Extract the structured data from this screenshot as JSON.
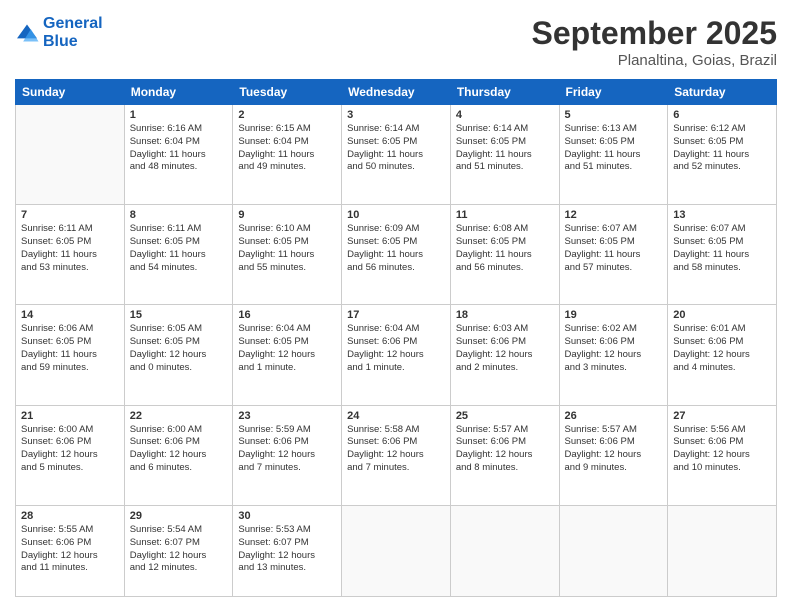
{
  "header": {
    "logo": {
      "line1": "General",
      "line2": "Blue"
    },
    "month": "September 2025",
    "location": "Planaltina, Goias, Brazil"
  },
  "days_of_week": [
    "Sunday",
    "Monday",
    "Tuesday",
    "Wednesday",
    "Thursday",
    "Friday",
    "Saturday"
  ],
  "weeks": [
    [
      {
        "day": "",
        "info": ""
      },
      {
        "day": "1",
        "info": "Sunrise: 6:16 AM\nSunset: 6:04 PM\nDaylight: 11 hours\nand 48 minutes."
      },
      {
        "day": "2",
        "info": "Sunrise: 6:15 AM\nSunset: 6:04 PM\nDaylight: 11 hours\nand 49 minutes."
      },
      {
        "day": "3",
        "info": "Sunrise: 6:14 AM\nSunset: 6:05 PM\nDaylight: 11 hours\nand 50 minutes."
      },
      {
        "day": "4",
        "info": "Sunrise: 6:14 AM\nSunset: 6:05 PM\nDaylight: 11 hours\nand 51 minutes."
      },
      {
        "day": "5",
        "info": "Sunrise: 6:13 AM\nSunset: 6:05 PM\nDaylight: 11 hours\nand 51 minutes."
      },
      {
        "day": "6",
        "info": "Sunrise: 6:12 AM\nSunset: 6:05 PM\nDaylight: 11 hours\nand 52 minutes."
      }
    ],
    [
      {
        "day": "7",
        "info": "Sunrise: 6:11 AM\nSunset: 6:05 PM\nDaylight: 11 hours\nand 53 minutes."
      },
      {
        "day": "8",
        "info": "Sunrise: 6:11 AM\nSunset: 6:05 PM\nDaylight: 11 hours\nand 54 minutes."
      },
      {
        "day": "9",
        "info": "Sunrise: 6:10 AM\nSunset: 6:05 PM\nDaylight: 11 hours\nand 55 minutes."
      },
      {
        "day": "10",
        "info": "Sunrise: 6:09 AM\nSunset: 6:05 PM\nDaylight: 11 hours\nand 56 minutes."
      },
      {
        "day": "11",
        "info": "Sunrise: 6:08 AM\nSunset: 6:05 PM\nDaylight: 11 hours\nand 56 minutes."
      },
      {
        "day": "12",
        "info": "Sunrise: 6:07 AM\nSunset: 6:05 PM\nDaylight: 11 hours\nand 57 minutes."
      },
      {
        "day": "13",
        "info": "Sunrise: 6:07 AM\nSunset: 6:05 PM\nDaylight: 11 hours\nand 58 minutes."
      }
    ],
    [
      {
        "day": "14",
        "info": "Sunrise: 6:06 AM\nSunset: 6:05 PM\nDaylight: 11 hours\nand 59 minutes."
      },
      {
        "day": "15",
        "info": "Sunrise: 6:05 AM\nSunset: 6:05 PM\nDaylight: 12 hours\nand 0 minutes."
      },
      {
        "day": "16",
        "info": "Sunrise: 6:04 AM\nSunset: 6:05 PM\nDaylight: 12 hours\nand 1 minute."
      },
      {
        "day": "17",
        "info": "Sunrise: 6:04 AM\nSunset: 6:06 PM\nDaylight: 12 hours\nand 1 minute."
      },
      {
        "day": "18",
        "info": "Sunrise: 6:03 AM\nSunset: 6:06 PM\nDaylight: 12 hours\nand 2 minutes."
      },
      {
        "day": "19",
        "info": "Sunrise: 6:02 AM\nSunset: 6:06 PM\nDaylight: 12 hours\nand 3 minutes."
      },
      {
        "day": "20",
        "info": "Sunrise: 6:01 AM\nSunset: 6:06 PM\nDaylight: 12 hours\nand 4 minutes."
      }
    ],
    [
      {
        "day": "21",
        "info": "Sunrise: 6:00 AM\nSunset: 6:06 PM\nDaylight: 12 hours\nand 5 minutes."
      },
      {
        "day": "22",
        "info": "Sunrise: 6:00 AM\nSunset: 6:06 PM\nDaylight: 12 hours\nand 6 minutes."
      },
      {
        "day": "23",
        "info": "Sunrise: 5:59 AM\nSunset: 6:06 PM\nDaylight: 12 hours\nand 7 minutes."
      },
      {
        "day": "24",
        "info": "Sunrise: 5:58 AM\nSunset: 6:06 PM\nDaylight: 12 hours\nand 7 minutes."
      },
      {
        "day": "25",
        "info": "Sunrise: 5:57 AM\nSunset: 6:06 PM\nDaylight: 12 hours\nand 8 minutes."
      },
      {
        "day": "26",
        "info": "Sunrise: 5:57 AM\nSunset: 6:06 PM\nDaylight: 12 hours\nand 9 minutes."
      },
      {
        "day": "27",
        "info": "Sunrise: 5:56 AM\nSunset: 6:06 PM\nDaylight: 12 hours\nand 10 minutes."
      }
    ],
    [
      {
        "day": "28",
        "info": "Sunrise: 5:55 AM\nSunset: 6:06 PM\nDaylight: 12 hours\nand 11 minutes."
      },
      {
        "day": "29",
        "info": "Sunrise: 5:54 AM\nSunset: 6:07 PM\nDaylight: 12 hours\nand 12 minutes."
      },
      {
        "day": "30",
        "info": "Sunrise: 5:53 AM\nSunset: 6:07 PM\nDaylight: 12 hours\nand 13 minutes."
      },
      {
        "day": "",
        "info": ""
      },
      {
        "day": "",
        "info": ""
      },
      {
        "day": "",
        "info": ""
      },
      {
        "day": "",
        "info": ""
      }
    ]
  ]
}
